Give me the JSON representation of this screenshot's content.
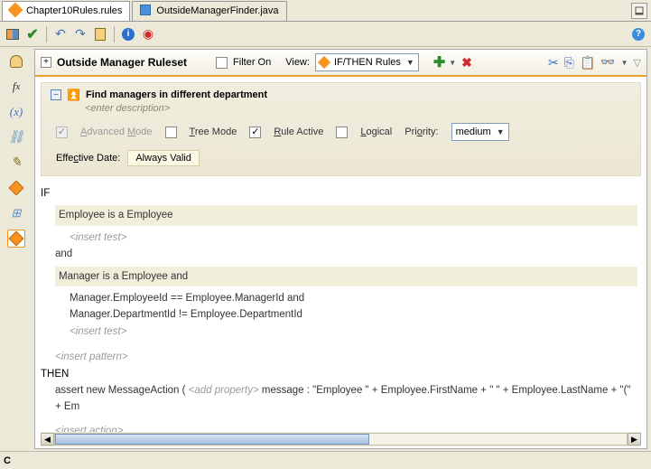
{
  "tabs": {
    "active": "Chapter10Rules.rules",
    "inactive": "OutsideManagerFinder.java"
  },
  "ruleset": {
    "title": "Outside Manager Ruleset",
    "filter_label": "Filter On",
    "view_label": "View:",
    "view_value": "IF/THEN Rules"
  },
  "rule": {
    "name": "Find managers in different department",
    "desc_hint": "<enter description>",
    "opts": {
      "advanced": "Advanced Mode",
      "tree": "Tree Mode",
      "active": "Rule Active",
      "logical": "Logical",
      "priority_label": "Priority:",
      "priority_value": "medium"
    },
    "effective": {
      "label": "Effective Date:",
      "value": "Always Valid"
    }
  },
  "body": {
    "if": "IF",
    "cond1": "Employee is a Employee",
    "insert_test": "<insert test>",
    "and": "and",
    "cond2": "Manager is a Employee  and",
    "line1": "Manager.EmployeeId  ==  Employee.ManagerId and",
    "line2": "Manager.DepartmentId  !=  Employee.DepartmentId",
    "insert_pattern": "<insert pattern>",
    "then": "THEN",
    "assert_prefix": "assert new MessageAction (  ",
    "add_prop": "<add property>",
    "assert_suffix": "  message : \"Employee \" +  Employee.FirstName + \" \" + Employee.LastName + \"(\" + Em",
    "insert_action": "<insert action>"
  },
  "status": {
    "c": "C"
  }
}
